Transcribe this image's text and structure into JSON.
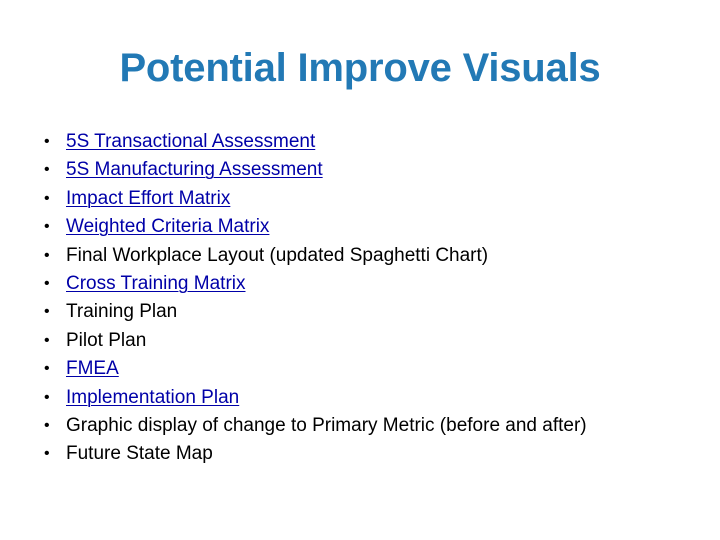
{
  "slide": {
    "title": "Potential Improve Visuals",
    "title_color": "#2279b5",
    "background_color": "#ffffff",
    "link_color": "#0000a8",
    "text_color": "#000000",
    "bullet_glyph": "•",
    "items": [
      {
        "label": "5S Transactional Assessment",
        "is_link": true
      },
      {
        "label": "5S Manufacturing Assessment",
        "is_link": true
      },
      {
        "label": "Impact Effort Matrix",
        "is_link": true
      },
      {
        "label": "Weighted Criteria Matrix",
        "is_link": true
      },
      {
        "label": "Final Workplace Layout (updated Spaghetti Chart)",
        "is_link": false
      },
      {
        "label": "Cross Training Matrix",
        "is_link": true
      },
      {
        "label": "Training Plan",
        "is_link": false
      },
      {
        "label": "Pilot Plan",
        "is_link": false
      },
      {
        "label": "FMEA",
        "is_link": true
      },
      {
        "label": "Implementation Plan",
        "is_link": true
      },
      {
        "label": "Graphic display of change to Primary Metric (before and after)",
        "is_link": false
      },
      {
        "label": "Future State Map",
        "is_link": false
      }
    ]
  }
}
